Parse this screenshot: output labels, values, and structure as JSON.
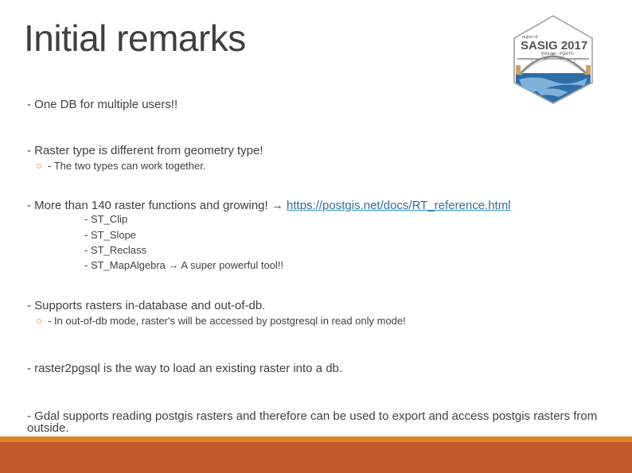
{
  "slide": {
    "title": "Initial remarks",
    "logo": {
      "icon": "sasig-2017-logo-icon",
      "name": "SASIG 2017",
      "subtitle": "Portugal - PORTO"
    },
    "items": [
      {
        "text": "- One DB for multiple users!!"
      },
      {
        "text": "- Raster type is different from geometry type!",
        "sub": "- The two types can work together."
      },
      {
        "text_before": "- More than 140 raster functions and growing!",
        "arrow": "→",
        "link": "https://postgis.net/docs/RT_reference.html",
        "functions": [
          "- ST_Clip",
          "- ST_Slope",
          "- ST_Reclass"
        ],
        "mapalgebra": {
          "name": "- ST_MapAlgebra",
          "arrow": "→",
          "note": "A super powerful tool!!"
        }
      },
      {
        "text": "- Supports rasters in-database and out-of-db.",
        "sub": "- In out-of-db mode, raster's will be accessed by postgresql in read only mode!"
      },
      {
        "text": "- raster2pgsql is the way to load an existing raster into a db."
      },
      {
        "text": "- Gdal supports reading postgis rasters and therefore can be used to export and access postgis rasters from outside."
      }
    ]
  },
  "colors": {
    "accent_orange": "#e0832a",
    "footer_rust": "#be592c",
    "link": "#2e6f9e"
  }
}
